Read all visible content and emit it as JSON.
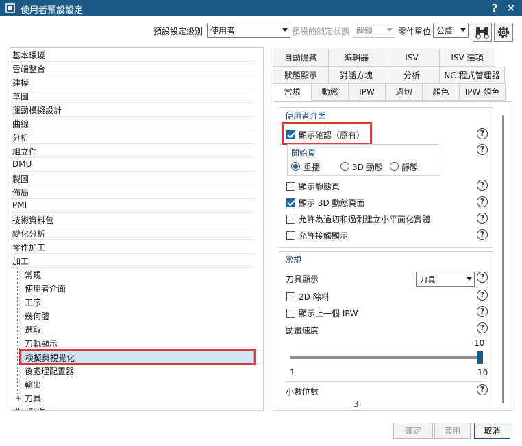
{
  "window": {
    "title": "使用者預設設定",
    "help_label": "?",
    "close_label": "✕"
  },
  "toolbar": {
    "level_label": "預設設定級別",
    "level_value": "使用者",
    "lock_label": "預設的鎖定狀態",
    "lock_value": "解鎖",
    "unit_label": "零件單位",
    "unit_value": "公釐"
  },
  "tree": {
    "items": [
      "基本環境",
      "雲端整合",
      "建模",
      "草圖",
      "運動模擬設計",
      "曲線",
      "分析",
      "組立件",
      "DMU",
      "製圖",
      "佈局",
      "PMI",
      "技術資料包",
      "變化分析",
      "零件加工",
      "加工"
    ],
    "sub_items": [
      "常規",
      "使用者介面",
      "工序",
      "幾何體",
      "選取",
      "刀軌顯示",
      "模擬與視覺化",
      "後處理配置器",
      "輸出"
    ],
    "expandable_item": "刀具",
    "expand_symbol": "+",
    "cut_item": "增材製造",
    "selected": "模擬與視覺化"
  },
  "tabs": {
    "row1": [
      "自動隱藏",
      "編輯器",
      "ISV",
      "ISV 選項"
    ],
    "row2": [
      "狀態顯示",
      "對話方塊",
      "分析",
      "NC 程式管理器"
    ],
    "row3": [
      "常規",
      "動態",
      "IPW",
      "過切",
      "顏色",
      "IPW 顏色"
    ],
    "active": "常規"
  },
  "ui_group": {
    "title": "使用者介面",
    "show_confirm": "顯示確認（原有）",
    "start_page_title": "開始頁",
    "radio_replay": "重播",
    "radio_3d": "3D 動態",
    "radio_static": "靜態",
    "show_static_page": "顯示靜態頁",
    "show_3d_page": "顯示 3D 動態頁面",
    "allow_facet": "允許為過切和過剩建立小平面化實體",
    "allow_contact": "允許接觸顯示"
  },
  "general_group": {
    "title": "常規",
    "tool_display_label": "刀具顯示",
    "tool_display_value": "刀具",
    "cb_2d": "2D 除料",
    "cb_prev_ipw": "顯示上一個 IPW",
    "anim_speed_label": "動畫速度",
    "anim_speed_value": "10",
    "anim_speed_fraction": 1.0,
    "slider_min": "1",
    "slider_max": "10",
    "decimals_label": "小數位數",
    "decimals_value": "3"
  },
  "buttons": {
    "ok": "確定",
    "apply": "套用",
    "cancel": "取消"
  },
  "help_glyph": "?"
}
